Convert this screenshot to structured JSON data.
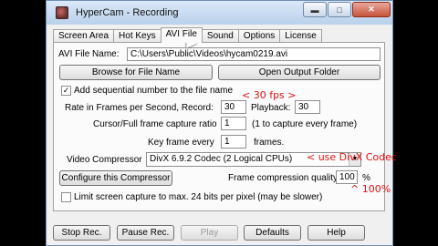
{
  "window": {
    "title": "HyperCam - Recording",
    "icon": "hypercam-icon"
  },
  "tabs": [
    "Screen Area",
    "Hot Keys",
    "AVI File",
    "Sound",
    "Options",
    "License"
  ],
  "active_tab": "AVI File",
  "avi": {
    "file_name_label": "AVI File Name:",
    "file_name_value": "C:\\Users\\Public\\Videos\\hycam0219.avi",
    "browse_label": "Browse for File Name",
    "open_folder_label": "Open Output Folder",
    "sequential_label": "Add sequential number to the file name",
    "sequential_checked": true,
    "rate_label": "Rate in Frames per Second,  Record:",
    "record_value": "30",
    "playback_label": "Playback:",
    "playback_value": "30",
    "capture_ratio_label": "Cursor/Full frame capture ratio",
    "capture_ratio_value": "1",
    "capture_ratio_note": "(1 to capture every frame)",
    "keyframe_label": "Key frame every",
    "keyframe_value": "1",
    "keyframe_unit": "frames.",
    "compressor_label": "Video Compressor",
    "compressor_value": "DivX 6.9.2 Codec (2 Logical CPUs)",
    "configure_label": "Configure this Compressor",
    "quality_label": "Frame compression quality",
    "quality_value": "100",
    "quality_unit": "%",
    "limit_label": "Limit screen capture to max. 24 bits per pixel (may be slower)",
    "limit_checked": false
  },
  "annotations": {
    "fps": "< 30 fps >",
    "divx": "< use DivX Codec",
    "quality": "^ 100%"
  },
  "footer": {
    "stop": "Stop Rec.",
    "pause": "Pause Rec.",
    "play": "Play",
    "defaults": "Defaults",
    "help": "Help"
  },
  "colors": {
    "annotation": "#e01010"
  }
}
